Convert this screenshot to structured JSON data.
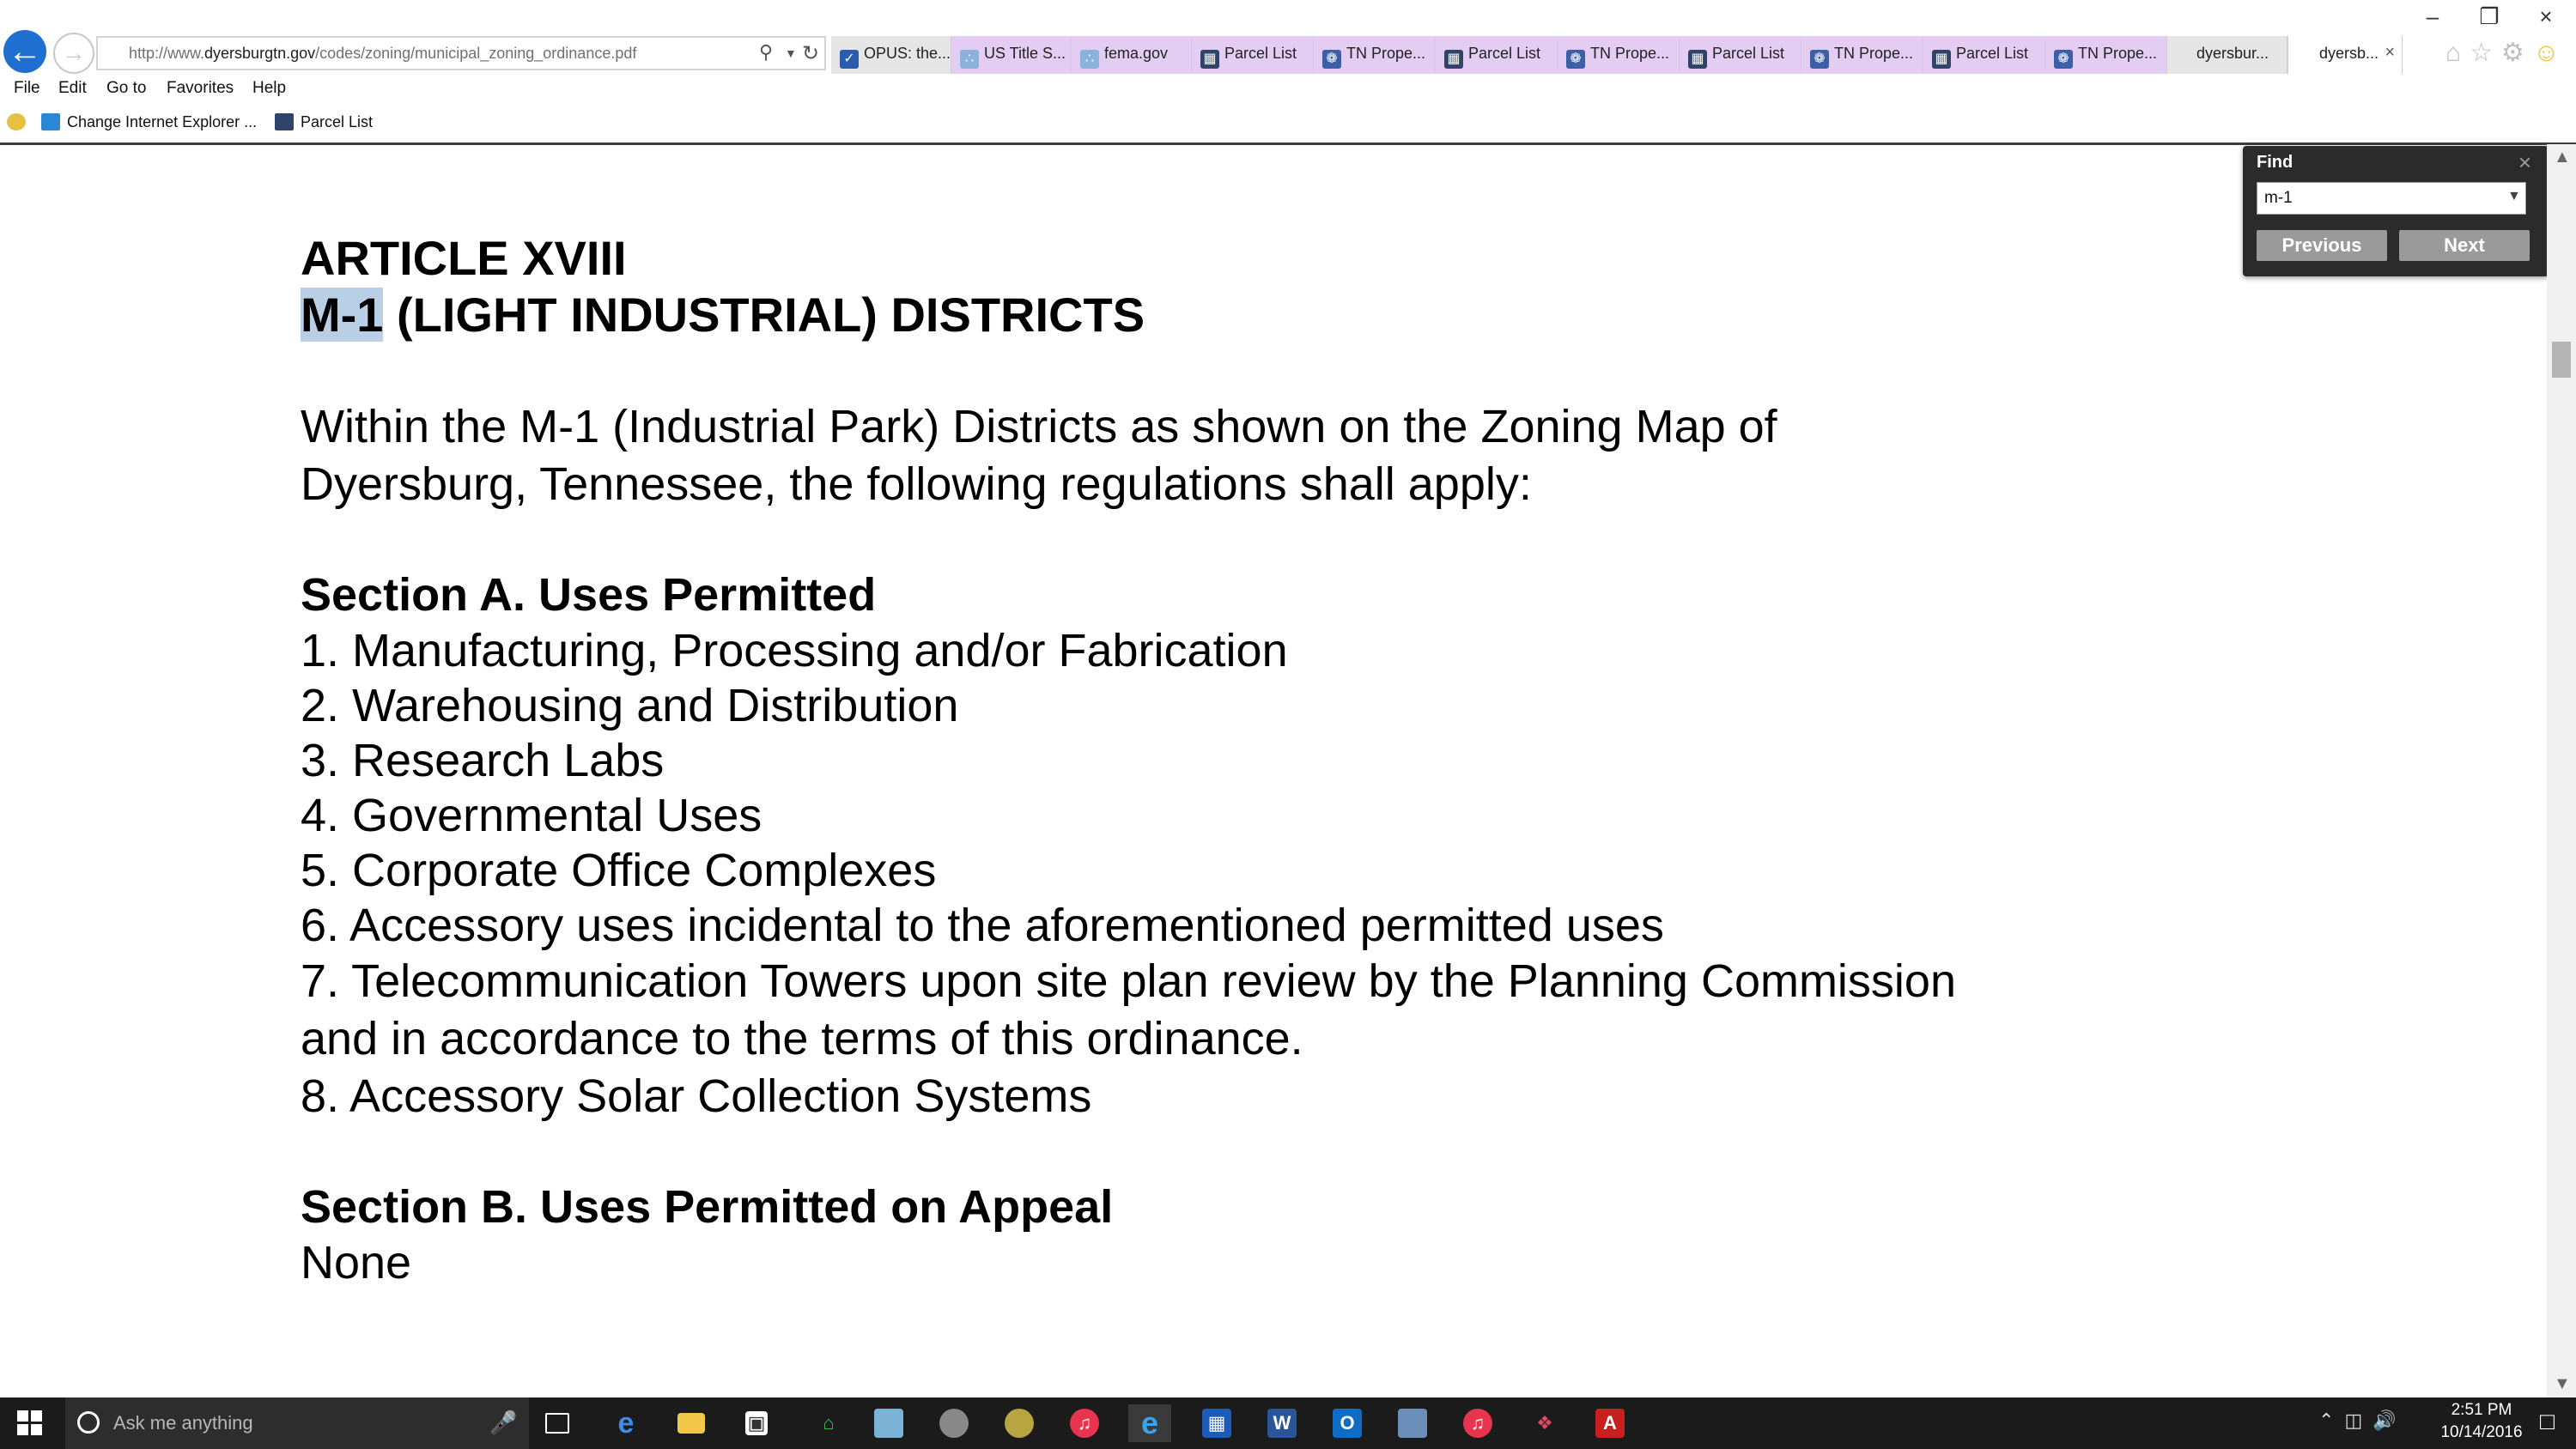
{
  "browser": {
    "url_prefix": "http://www.",
    "url_domain": "dyersburgtn.gov",
    "url_path": "/codes/zoning/municipal_zoning_ordinance.pdf",
    "tabs": [
      {
        "label": "OPUS: the...",
        "icon": "shield-icon"
      },
      {
        "label": "US Title S...",
        "icon": "document-icon"
      },
      {
        "label": "fema.gov",
        "icon": "document-icon"
      },
      {
        "label": "Parcel List",
        "icon": "grid-icon"
      },
      {
        "label": "TN Prope...",
        "icon": "globe-icon"
      },
      {
        "label": "Parcel List",
        "icon": "grid-icon"
      },
      {
        "label": "TN Prope...",
        "icon": "globe-icon"
      },
      {
        "label": "Parcel List",
        "icon": "grid-icon"
      },
      {
        "label": "TN Prope...",
        "icon": "globe-icon"
      },
      {
        "label": "Parcel List",
        "icon": "grid-icon"
      },
      {
        "label": "TN Prope...",
        "icon": "globe-icon"
      },
      {
        "label": "dyersbur...",
        "icon": ""
      },
      {
        "label": "dyersb...",
        "icon": "",
        "active": true
      }
    ],
    "menu": [
      "File",
      "Edit",
      "Go to",
      "Favorites",
      "Help"
    ],
    "favorites": [
      {
        "label": "Change Internet Explorer ...",
        "icon": "windows-icon"
      },
      {
        "label": "Parcel List",
        "icon": "grid-icon"
      }
    ]
  },
  "document": {
    "article": "ARTICLE XVIII",
    "district_highlight": "M-1",
    "district_rest": " (LIGHT INDUSTRIAL) DISTRICTS",
    "intro_line1": "Within the M-1 (Industrial Park) Districts as shown on the Zoning Map of",
    "intro_line2": "Dyersburg,  Tennessee, the following regulations shall apply:",
    "section_a_heading": "Section A. Uses Permitted",
    "section_a_items": [
      "1. Manufacturing, Processing and/or Fabrication",
      "2. Warehousing and Distribution",
      "3. Research Labs",
      "4. Governmental Uses",
      "5. Corporate Office Complexes",
      "6. Accessory uses incidental to the aforementioned permitted uses",
      "7. Telecommunication Towers upon site plan review by the Planning Commission",
      "and in  accordance to the terms of this ordinance.",
      "8.  Accessory Solar Collection Systems"
    ],
    "section_b_heading": "Section B. Uses Permitted on Appeal",
    "section_b_text": "None"
  },
  "find": {
    "title": "Find",
    "value": "m-1",
    "previous_label": "Previous",
    "next_label": "Next"
  },
  "scroll": {
    "position_fraction": 0.145
  },
  "taskbar": {
    "search_placeholder": "Ask me anything",
    "time": "2:51 PM",
    "date": "10/14/2016"
  },
  "colors": {
    "highlight": "#b9cfe6",
    "back_button": "#1e6fd0",
    "purple_tab": "#e4cdf3"
  }
}
